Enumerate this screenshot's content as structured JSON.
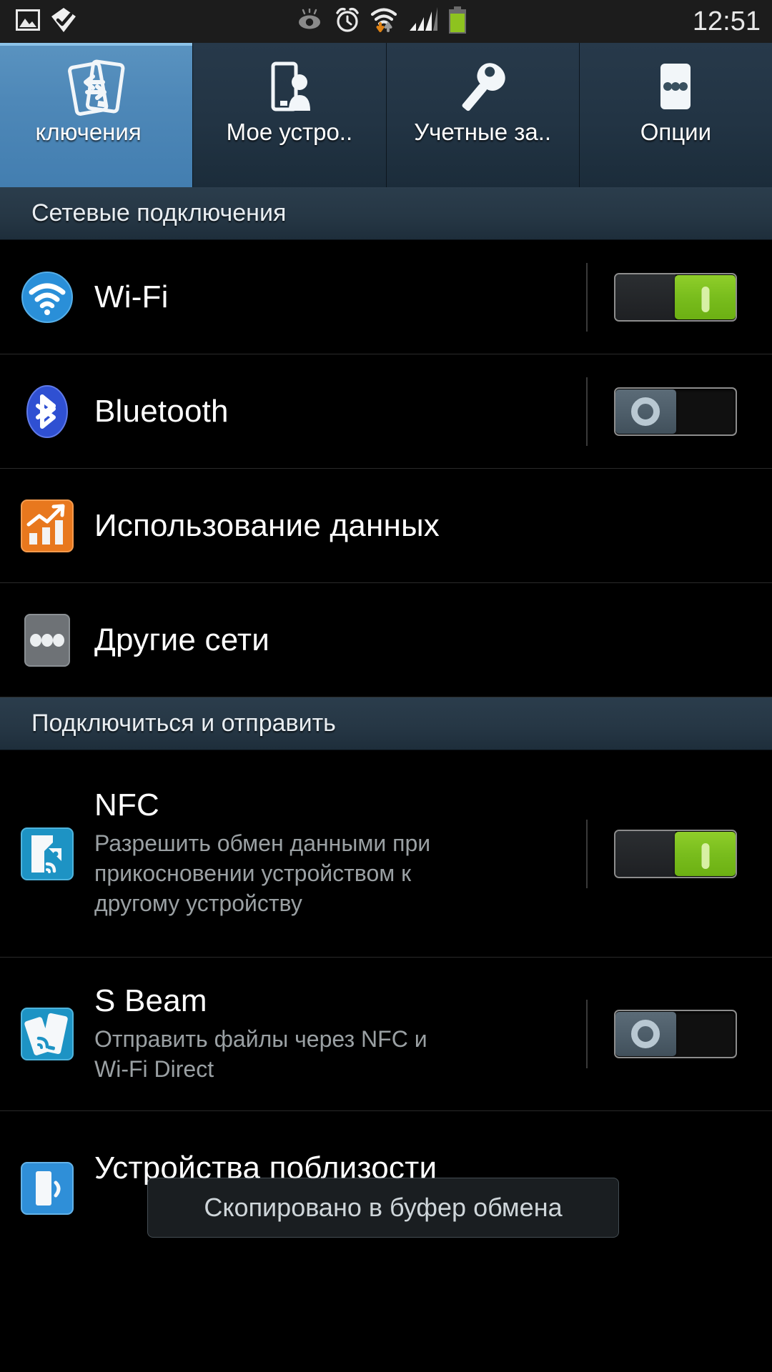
{
  "status_bar": {
    "time": "12:51",
    "left_icons": [
      {
        "name": "gallery-image-icon",
        "label": "Изображение"
      },
      {
        "name": "check-badge-icon",
        "label": "Отметка"
      }
    ],
    "right_icons": [
      {
        "name": "smart-stay-eye-icon",
        "label": "Smart stay"
      },
      {
        "name": "alarm-clock-icon",
        "label": "Будильник"
      },
      {
        "name": "wifi-data-transfer-icon",
        "label": "Wi-Fi"
      },
      {
        "name": "signal-bars-icon",
        "label": "Сигнал"
      },
      {
        "name": "battery-icon",
        "label": "Батарея"
      }
    ],
    "battery_level_percent": 80,
    "signal_bars_lit": 3,
    "signal_bars_total": 4,
    "colors": {
      "battery_fill": "#8ec31f",
      "download_arrow": "#e08214"
    }
  },
  "tabs": [
    {
      "label": "ключения",
      "full_label": "Подключения",
      "icon": "connections-icon",
      "active": true
    },
    {
      "label": "Мое устро..",
      "full_label": "Мое устройство",
      "icon": "my-device-icon",
      "active": false
    },
    {
      "label": "Учетные за..",
      "full_label": "Учетные записи",
      "icon": "accounts-key-icon",
      "active": false
    },
    {
      "label": "Опции",
      "full_label": "Опции",
      "icon": "more-options-icon",
      "active": false
    }
  ],
  "sections": [
    {
      "title": "Сетевые подключения",
      "rows": [
        {
          "title": "Wi-Fi",
          "sub": "",
          "icon": "wifi-icon",
          "toggle": "on"
        },
        {
          "title": "Bluetooth",
          "sub": "",
          "icon": "bluetooth-icon",
          "toggle": "off"
        },
        {
          "title": "Использование данных",
          "sub": "",
          "icon": "data-usage-icon",
          "toggle": "none"
        },
        {
          "title": "Другие сети",
          "sub": "",
          "icon": "more-networks-icon",
          "toggle": "none"
        }
      ]
    },
    {
      "title": "Подключиться и отправить",
      "rows": [
        {
          "title": "NFC",
          "sub": "Разрешить обмен данными при прикосновении устройством к другому устройству",
          "icon": "nfc-icon",
          "toggle": "on"
        },
        {
          "title": "S Beam",
          "sub": "Отправить файлы через NFC и Wi-Fi Direct",
          "icon": "s-beam-icon",
          "toggle": "off"
        },
        {
          "title": "Устройства поблизости",
          "sub": "",
          "icon": "nearby-devices-icon",
          "toggle": "none"
        }
      ]
    }
  ],
  "toast": {
    "message": "Скопировано в буфер обмена"
  },
  "colors": {
    "tab_active": "#4e88b8",
    "section_header_bg": "#263745",
    "background": "#000000",
    "toggle_on": "#79bd1d",
    "toggle_off_thumb": "#4d5d69",
    "wifi_icon": "#2a8fd8",
    "bluetooth_icon": "#2f50d2",
    "data_usage_icon": "#e8781e",
    "more_networks_icon": "#6e7276",
    "nfc_icon": "#1d93c4",
    "s_beam_icon": "#1d93c4",
    "nearby_devices_icon": "#2f8fd8",
    "subtitle_text": "#9aa0a3"
  }
}
